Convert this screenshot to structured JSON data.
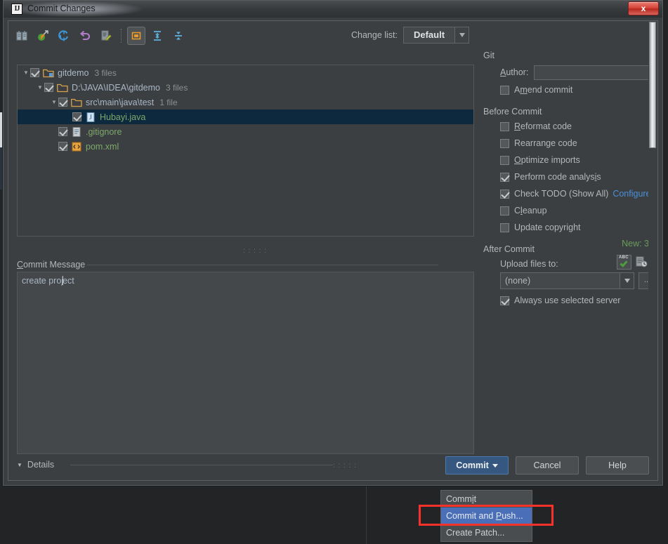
{
  "window": {
    "title": "Commit Changes",
    "app_icon": "IJ",
    "close_label": "x"
  },
  "toolbar": {
    "buttons": [
      {
        "name": "show-diff-icon",
        "label": ""
      },
      {
        "name": "revert-icon",
        "label": ""
      },
      {
        "name": "refresh-icon",
        "label": ""
      },
      {
        "name": "rollback-icon",
        "label": ""
      },
      {
        "name": "edit-source-icon",
        "label": ""
      },
      {
        "name": "group-by-directory-icon",
        "label": "",
        "selected": true
      },
      {
        "name": "expand-all-icon",
        "label": ""
      },
      {
        "name": "collapse-all-icon",
        "label": ""
      }
    ]
  },
  "changelist": {
    "label": "Change list:",
    "value": "Default",
    "arrow": "▼"
  },
  "tree": {
    "rows": [
      {
        "caret": "▼",
        "indent": 0,
        "checked": true,
        "icon": "module-folder-icon",
        "name": "gitdemo",
        "count": "3 files",
        "color": "normal",
        "selected": false
      },
      {
        "caret": "▼",
        "indent": 1,
        "checked": true,
        "icon": "folder-icon",
        "name": "D:\\JAVA\\IDEA\\gitdemo",
        "count": "3 files",
        "color": "normal",
        "selected": false
      },
      {
        "caret": "▼",
        "indent": 2,
        "checked": true,
        "icon": "folder-icon",
        "name": "src\\main\\java\\test",
        "count": "1 file",
        "color": "normal",
        "selected": false
      },
      {
        "caret": "",
        "indent": 3,
        "checked": true,
        "icon": "java-file-icon",
        "name": "Hubayi.java",
        "count": "",
        "color": "green",
        "selected": true
      },
      {
        "caret": "",
        "indent": 2,
        "checked": true,
        "icon": "text-file-icon",
        "name": ".gitignore",
        "count": "",
        "color": "green",
        "selected": false
      },
      {
        "caret": "",
        "indent": 2,
        "checked": true,
        "icon": "xml-file-icon",
        "name": "pom.xml",
        "count": "",
        "color": "green",
        "selected": false
      }
    ],
    "new_count": "New: 3"
  },
  "commit_message": {
    "label": "Commit Message",
    "label_mnemonic": "C",
    "value": "create project",
    "spellcheck_icon_text": "ABC",
    "icons": [
      "spellcheck-icon",
      "message-history-icon"
    ]
  },
  "details": {
    "label": "Details",
    "caret": "▼"
  },
  "git_section": {
    "title": "Git",
    "author_label": "Author:",
    "author_value": "",
    "amend_label": "Amend commit",
    "amend_checked": false
  },
  "before_commit": {
    "title": "Before Commit",
    "items": [
      {
        "label": "Reformat code",
        "checked": false
      },
      {
        "label": "Rearrange code",
        "checked": false
      },
      {
        "label": "Optimize imports",
        "checked": false
      },
      {
        "label": "Perform code analysis",
        "checked": true
      },
      {
        "label": "Check TODO (Show All)",
        "checked": true,
        "link": "Configure"
      },
      {
        "label": "Cleanup",
        "checked": false
      },
      {
        "label": "Update copyright",
        "checked": false
      }
    ]
  },
  "after_commit": {
    "title": "After Commit",
    "upload_label": "Upload files to:",
    "upload_value": "(none)",
    "upload_arrow": "▼",
    "browse_label": "...",
    "always_label": "Always use selected server",
    "always_checked": true
  },
  "buttons": {
    "commit": "Commit",
    "cancel": "Cancel",
    "help": "Help"
  },
  "menu": {
    "items": [
      {
        "label": "Commit",
        "highlighted": false
      },
      {
        "label": "Commit and Push...",
        "highlighted": true
      },
      {
        "label": "Create Patch...",
        "highlighted": false
      }
    ]
  },
  "colors": {
    "accent_blue": "#365880",
    "menu_highlight": "#4a6fb8",
    "highlight_box": "#f8312a",
    "link": "#4a90d9",
    "new_file_green": "#6a9c5a",
    "selection_row": "#0d293e"
  }
}
